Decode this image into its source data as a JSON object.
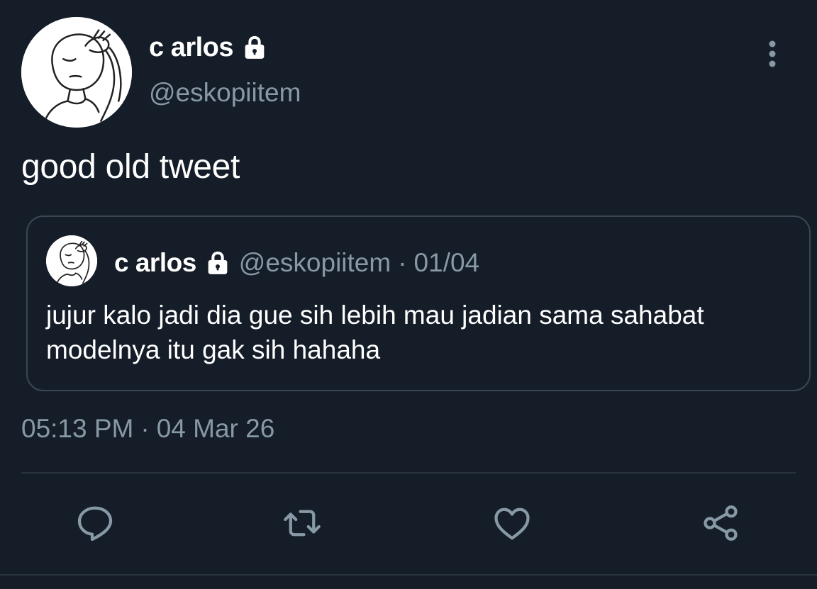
{
  "tweet": {
    "author": {
      "name": "c arlos",
      "handle": "@eskopiitem",
      "avatar_icon": "facepalm-doodle-avatar",
      "protected_icon": "lock-icon"
    },
    "text": "good old tweet",
    "quoted": {
      "author_name": "c arlos",
      "author_handle": "@eskopiitem",
      "separator": "·",
      "date": "01/04",
      "text": "jujur kalo jadi dia gue sih lebih mau jadian sama sahabat modelnya itu gak sih hahaha"
    },
    "timestamp": {
      "time": "05:13 PM",
      "separator": "·",
      "date": "04 Mar 26"
    },
    "actions": {
      "reply_icon": "reply-icon",
      "retweet_icon": "retweet-icon",
      "like_icon": "heart-icon",
      "share_icon": "share-icon"
    },
    "more_icon": "more-vertical-icon"
  },
  "colors": {
    "background": "#151d29",
    "text_primary": "#ffffff",
    "text_secondary": "#8899a6",
    "border": "#3a4654",
    "icon": "#8899a6"
  }
}
